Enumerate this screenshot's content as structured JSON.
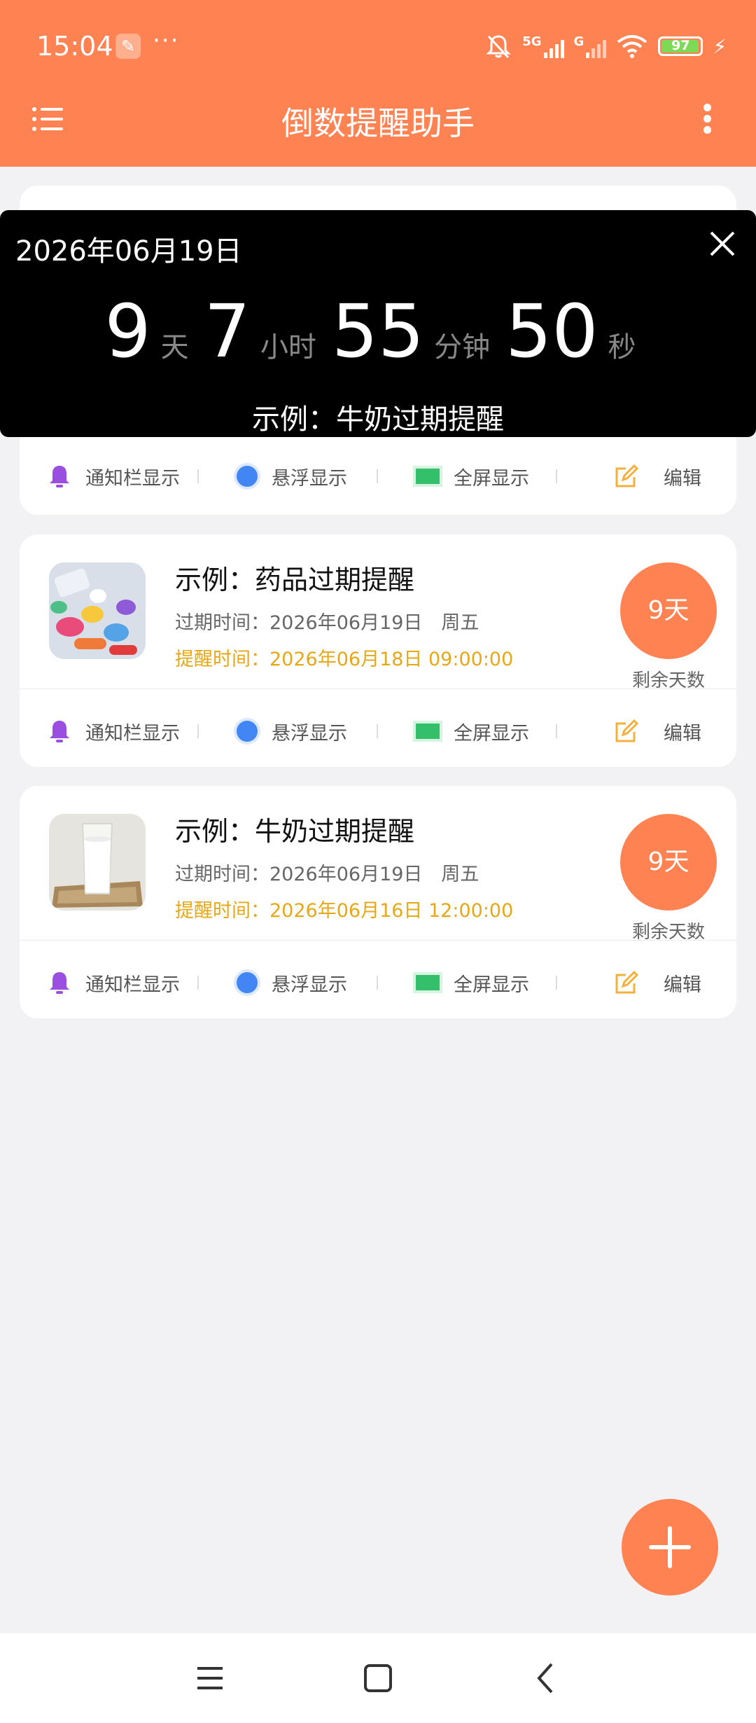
{
  "status_bar": {
    "time": "15:04",
    "icons": [
      "wrench-icon",
      "more-dots-icon",
      "bell-muted-icon",
      "signal-5g-icon",
      "signal-g-icon",
      "wifi-icon",
      "battery-icon",
      "charging-icon"
    ],
    "sig1": "5G",
    "sig2": "G",
    "battery_level": "97",
    "battery_fraction": 0.97
  },
  "header": {
    "title": "倒数提醒助手",
    "menu_icon": "menu-icon",
    "more_icon": "more-vertical-icon"
  },
  "colors": {
    "accent": "#ff8352",
    "remind_text": "#e6a817",
    "notify_icon": "#9b4fe0",
    "float_icon": "#4285f4",
    "fullscreen_icon": "#34c06a",
    "edit_icon": "#f2b13c"
  },
  "overlay": {
    "date": "2026年06月19日",
    "days": "9",
    "days_unit": "天",
    "hours": "7",
    "hours_unit": "小时",
    "minutes": "55",
    "minutes_unit": "分钟",
    "seconds": "50",
    "seconds_unit": "秒",
    "title": "示例：牛奶过期提醒",
    "close_icon": "close-icon"
  },
  "option_labels": {
    "notify": "通知栏显示",
    "float": "悬浮显示",
    "fullscreen": "全屏显示",
    "edit": "编辑"
  },
  "cards": [
    {
      "title": "示例：药品过期提醒",
      "expiry": "过期时间：2026年06月19日　周五",
      "remind": "提醒时间：2026年06月18日 09:00:00",
      "days_badge": "9天",
      "days_label": "剩余天数",
      "image": "medicine-pills-image"
    },
    {
      "title": "示例：牛奶过期提醒",
      "expiry": "过期时间：2026年06月19日　周五",
      "remind": "提醒时间：2026年06月16日 12:00:00",
      "days_badge": "9天",
      "days_label": "剩余天数",
      "image": "milk-glass-image"
    }
  ],
  "fab": {
    "icon": "plus-icon"
  },
  "nav_bar": {
    "icons": [
      "nav-menu-icon",
      "nav-home-icon",
      "nav-back-icon"
    ]
  }
}
